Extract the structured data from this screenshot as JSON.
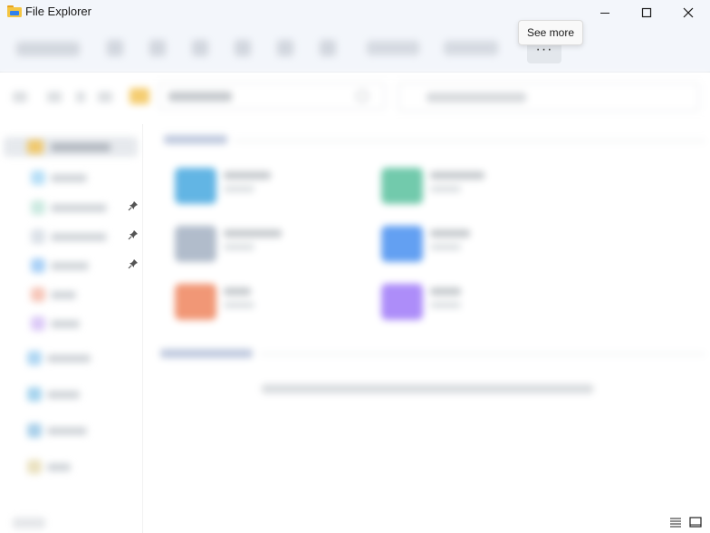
{
  "window": {
    "title": "File Explorer",
    "controls": {
      "minimize": "minimize-icon",
      "maximize": "maximize-icon",
      "close": "close-icon"
    }
  },
  "command_bar": {
    "see_more": {
      "label": "···",
      "tooltip": "See more"
    }
  },
  "icons": {
    "pin": "pin-icon",
    "details_view": "details-view-icon",
    "tiles_view": "tiles-view-icon"
  },
  "colors": {
    "chrome_background": "#f3f6fb",
    "folder_yellow": "#f2c14e",
    "tile_blue": "#2d9cdb",
    "tile_teal": "#27ae7f",
    "tile_slate": "#7d8fa8",
    "tile_sky": "#2f80ed",
    "tile_orange": "#eb6b3c",
    "tile_purple": "#8a5cf6"
  }
}
